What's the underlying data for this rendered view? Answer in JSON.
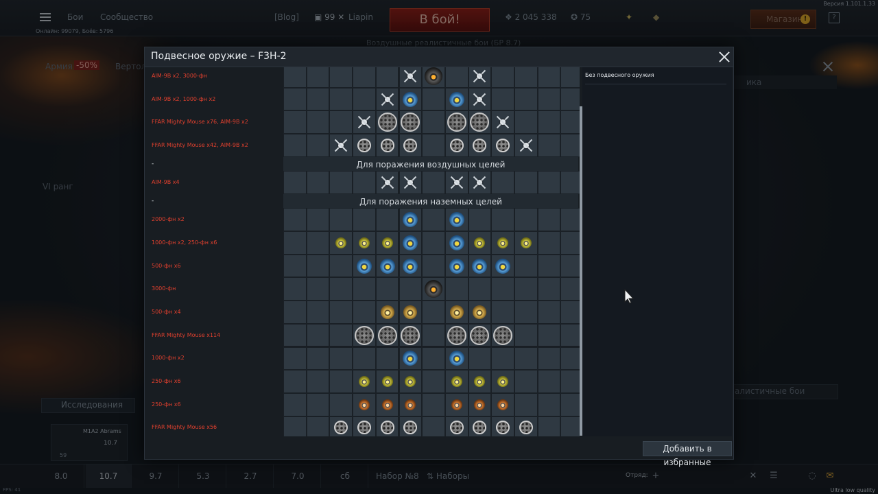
{
  "topbar": {
    "menu_battles": "Бои",
    "menu_community": "Сообщество",
    "blog": "[Blog]",
    "player_level": "99",
    "player_name": "Liapin",
    "battle_button": "В бой!",
    "silver_lions": "2 045 338",
    "golden_eagles": "75",
    "shop": "Магазин",
    "online_stats": "Онлайн: 99079, Боёв: 5796",
    "version": "Версия 1.101.1.33"
  },
  "background": {
    "mode_subtitle": "Воздушные реалистичные бои (БР 8.7)",
    "tab_army": "Армия",
    "discount": "-50%",
    "tab_helicopters": "Вертолё",
    "rank": "VI ранг",
    "research": "Исследования",
    "tank_name": "M1A2 Abrams",
    "tank_br": "10.7",
    "tank_count": "59",
    "right_tab_fragment": "ика",
    "mode_select": "алистичные бои"
  },
  "modal": {
    "title": "Подвесное оружие – F3H-2",
    "detail_text": "Без подвесного оружия",
    "favorite_button": "Добавить в избранные",
    "rows": [
      {
        "type": "loadout",
        "label": "AIM-9B x2,  3000-фн",
        "slots": [
          "",
          "",
          "",
          "",
          "",
          "aim",
          "dark",
          "",
          "aim",
          "",
          "",
          "",
          ""
        ]
      },
      {
        "type": "loadout",
        "label": "AIM-9B x2,  1000-фн x2",
        "slots": [
          "",
          "",
          "",
          "",
          "aim",
          "blue",
          "",
          "blue",
          "aim",
          "",
          "",
          "",
          ""
        ]
      },
      {
        "type": "loadout",
        "label": "FFAR Mighty Mouse x76,  AIM-9B x2",
        "slots": [
          "",
          "",
          "",
          "aim",
          "rockL",
          "rockL",
          "",
          "rockL",
          "rockL",
          "aim",
          "",
          "",
          ""
        ]
      },
      {
        "type": "loadout",
        "label": "FFAR Mighty Mouse x42,  AIM-9B x2",
        "slots": [
          "",
          "",
          "aim",
          "rockS",
          "rockS",
          "rockS",
          "",
          "rockS",
          "rockS",
          "rockS",
          "aim",
          "",
          ""
        ]
      },
      {
        "type": "section",
        "label": "-",
        "title": "Для поражения воздушных целей"
      },
      {
        "type": "loadout",
        "label": "AIM-9B x4",
        "slots": [
          "",
          "",
          "",
          "",
          "aim",
          "aim",
          "",
          "aim",
          "aim",
          "",
          "",
          "",
          ""
        ]
      },
      {
        "type": "section",
        "label": "-",
        "title": "Для поражения наземных целей"
      },
      {
        "type": "loadout",
        "label": "2000-фн x2",
        "slots": [
          "",
          "",
          "",
          "",
          "",
          "blue",
          "",
          "blue",
          "",
          "",
          "",
          "",
          ""
        ]
      },
      {
        "type": "loadout",
        "label": "1000-фн x2,  250-фн x6",
        "slots": [
          "",
          "",
          "yel",
          "yel",
          "yel",
          "blue",
          "",
          "blue",
          "yel",
          "yel",
          "yel",
          "",
          ""
        ]
      },
      {
        "type": "loadout",
        "label": "500-фн x6",
        "slots": [
          "",
          "",
          "",
          "blue",
          "blue",
          "blue",
          "",
          "blue",
          "blue",
          "blue",
          "",
          "",
          ""
        ]
      },
      {
        "type": "loadout",
        "label": "3000-фн",
        "slots": [
          "",
          "",
          "",
          "",
          "",
          "",
          "dark",
          "",
          "",
          "",
          "",
          "",
          ""
        ]
      },
      {
        "type": "loadout",
        "label": "500-фн x4",
        "slots": [
          "",
          "",
          "",
          "",
          "gold",
          "gold",
          "",
          "gold",
          "gold",
          "",
          "",
          "",
          ""
        ]
      },
      {
        "type": "loadout",
        "label": "FFAR Mighty Mouse x114",
        "slots": [
          "",
          "",
          "",
          "rockL",
          "rockL",
          "rockL",
          "",
          "rockL",
          "rockL",
          "rockL",
          "",
          "",
          ""
        ]
      },
      {
        "type": "loadout",
        "label": "1000-фн x2",
        "slots": [
          "",
          "",
          "",
          "",
          "",
          "blue",
          "",
          "blue",
          "",
          "",
          "",
          "",
          ""
        ]
      },
      {
        "type": "loadout",
        "label": "250-фн x6",
        "slots": [
          "",
          "",
          "",
          "yel",
          "yel",
          "yel",
          "",
          "yel",
          "yel",
          "yel",
          "",
          "",
          ""
        ]
      },
      {
        "type": "loadout",
        "label": "250-фн x6",
        "slots": [
          "",
          "",
          "",
          "org",
          "org",
          "org",
          "",
          "org",
          "org",
          "org",
          "",
          "",
          ""
        ]
      },
      {
        "type": "loadout",
        "label": "FFAR Mighty Mouse x56",
        "slots": [
          "",
          "",
          "rockS",
          "rockS",
          "rockS",
          "rockS",
          "",
          "rockS",
          "rockS",
          "rockS",
          "rockS",
          "",
          ""
        ]
      }
    ]
  },
  "bottombar": {
    "br_tabs": [
      "8.0",
      "10.7",
      "9.7",
      "5.3",
      "2.7",
      "7.0",
      "сб"
    ],
    "active_tab": 1,
    "preset": "Набор №8",
    "presets": "Наборы",
    "squad": "Отряд:",
    "fps": "FPS: 41",
    "quality": "Ultra low quality"
  },
  "colors": {
    "loadout_text": "#e0402e",
    "accent_red": "#8e1a12",
    "panel": "#181d22"
  }
}
